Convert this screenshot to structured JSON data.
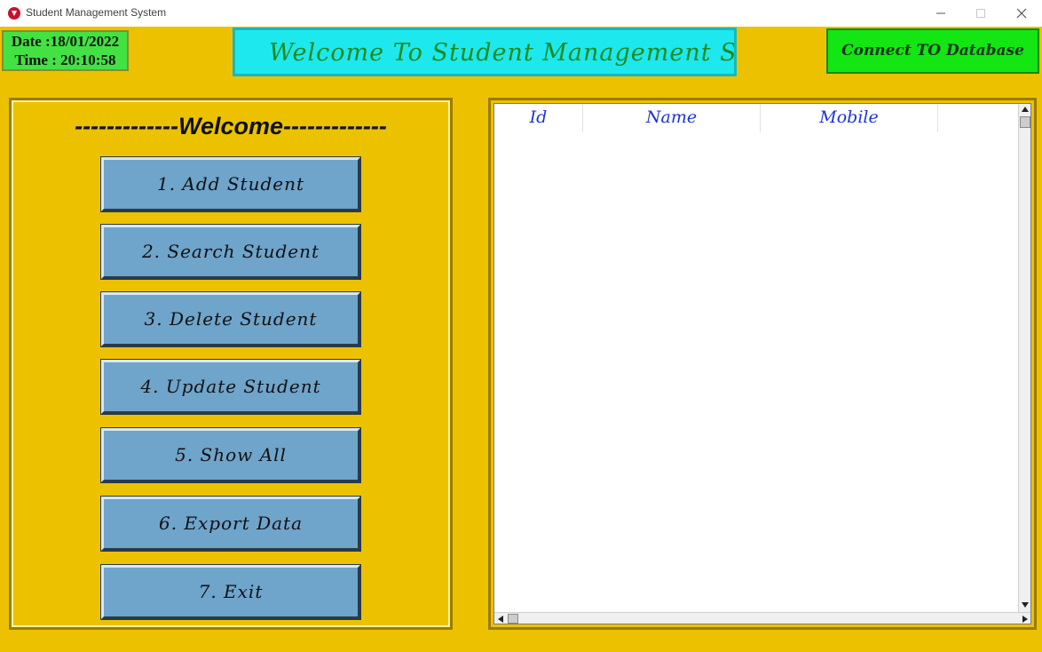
{
  "window": {
    "title": "Student Management System",
    "icon": "app-shield-icon",
    "controls": {
      "minimize": "minimize-icon",
      "maximize": "maximize-icon",
      "close": "close-icon"
    }
  },
  "status": {
    "date_line": "Date :18/01/2022",
    "time_line": "Time : 20:10:58"
  },
  "banner": {
    "text": "Welcome To Student Management Syst"
  },
  "connect_button": {
    "label": "Connect TO Database"
  },
  "menu": {
    "heading": "-------------Welcome-------------",
    "items": [
      {
        "label": "1. Add Student"
      },
      {
        "label": "2. Search Student"
      },
      {
        "label": "3. Delete Student"
      },
      {
        "label": "4. Update Student"
      },
      {
        "label": "5. Show All"
      },
      {
        "label": "6. Export Data"
      },
      {
        "label": "7. Exit"
      }
    ]
  },
  "table": {
    "columns": [
      "Id",
      "Name",
      "Mobile",
      ""
    ],
    "rows": []
  },
  "colors": {
    "background": "#ecc200",
    "datetime_bg": "#43e243",
    "banner_bg": "#1de8ee",
    "banner_text": "#1e8a1e",
    "connect_bg": "#13e613",
    "button_bg": "#6fa4cb",
    "header_text": "#1a33d6"
  }
}
